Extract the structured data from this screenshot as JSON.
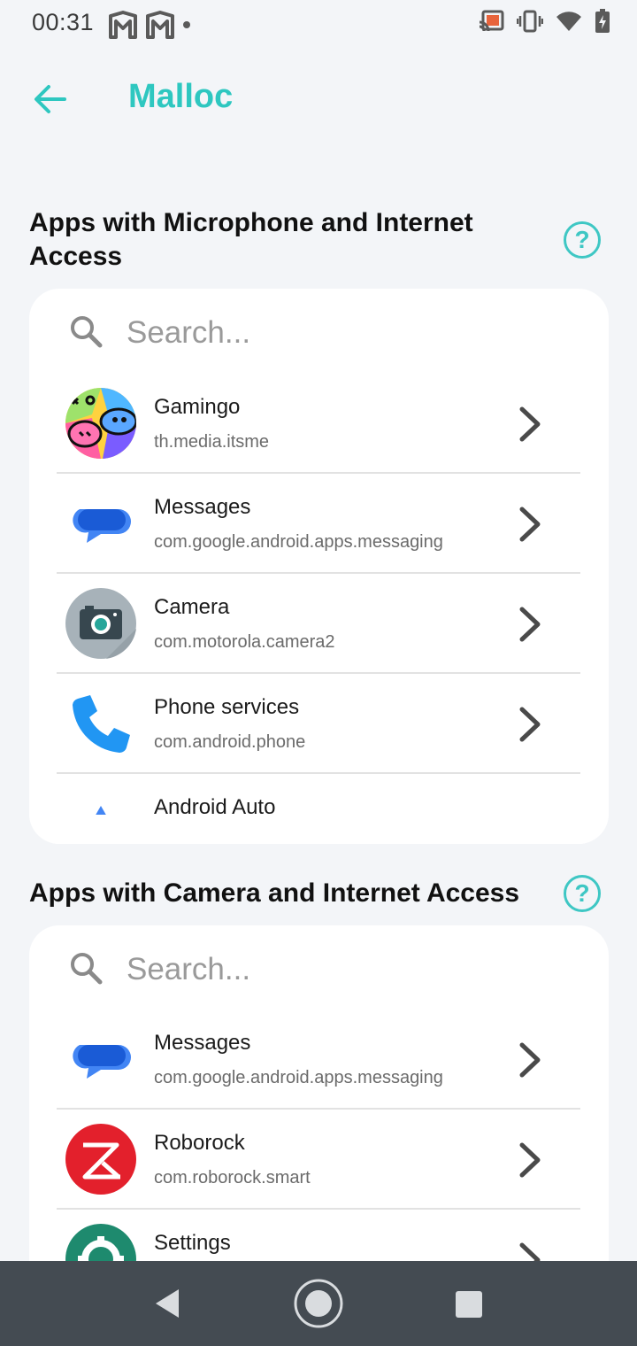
{
  "status_bar": {
    "time": "00:31",
    "left_icons": [
      "malloc-shield-icon",
      "malloc-shield-icon",
      "notification-dot-icon"
    ],
    "right_icons": [
      "cast-icon",
      "vibrate-icon",
      "wifi-icon",
      "battery-charging-icon"
    ]
  },
  "app_bar": {
    "title": "Malloc",
    "back_icon": "arrow-back-icon"
  },
  "colors": {
    "accent": "#2ec7c0",
    "background": "#f3f5f8",
    "card": "#ffffff",
    "nav_bar": "#444b52"
  },
  "microphone_section": {
    "title": "Apps with Microphone and Internet Access",
    "help_label": "?",
    "search_placeholder": "Search...",
    "apps": [
      {
        "name": "Gamingo",
        "package": "th.media.itsme",
        "icon": "gamingo-icon"
      },
      {
        "name": "Messages",
        "package": "com.google.android.apps.messaging",
        "icon": "messages-icon"
      },
      {
        "name": "Camera",
        "package": "com.motorola.camera2",
        "icon": "camera-icon"
      },
      {
        "name": "Phone services",
        "package": "com.android.phone",
        "icon": "phone-icon"
      },
      {
        "name": "Android Auto",
        "package": "",
        "icon": "android-auto-icon"
      }
    ]
  },
  "camera_section": {
    "title": "Apps with Camera and Internet Access",
    "help_label": "?",
    "search_placeholder": "Search...",
    "apps": [
      {
        "name": "Messages",
        "package": "com.google.android.apps.messaging",
        "icon": "messages-icon"
      },
      {
        "name": "Roborock",
        "package": "com.roborock.smart",
        "icon": "roborock-icon"
      },
      {
        "name": "Settings",
        "package": "",
        "icon": "settings-icon"
      }
    ]
  },
  "nav_bar": {
    "buttons": [
      "nav-back-icon",
      "nav-home-icon",
      "nav-recents-icon"
    ]
  }
}
